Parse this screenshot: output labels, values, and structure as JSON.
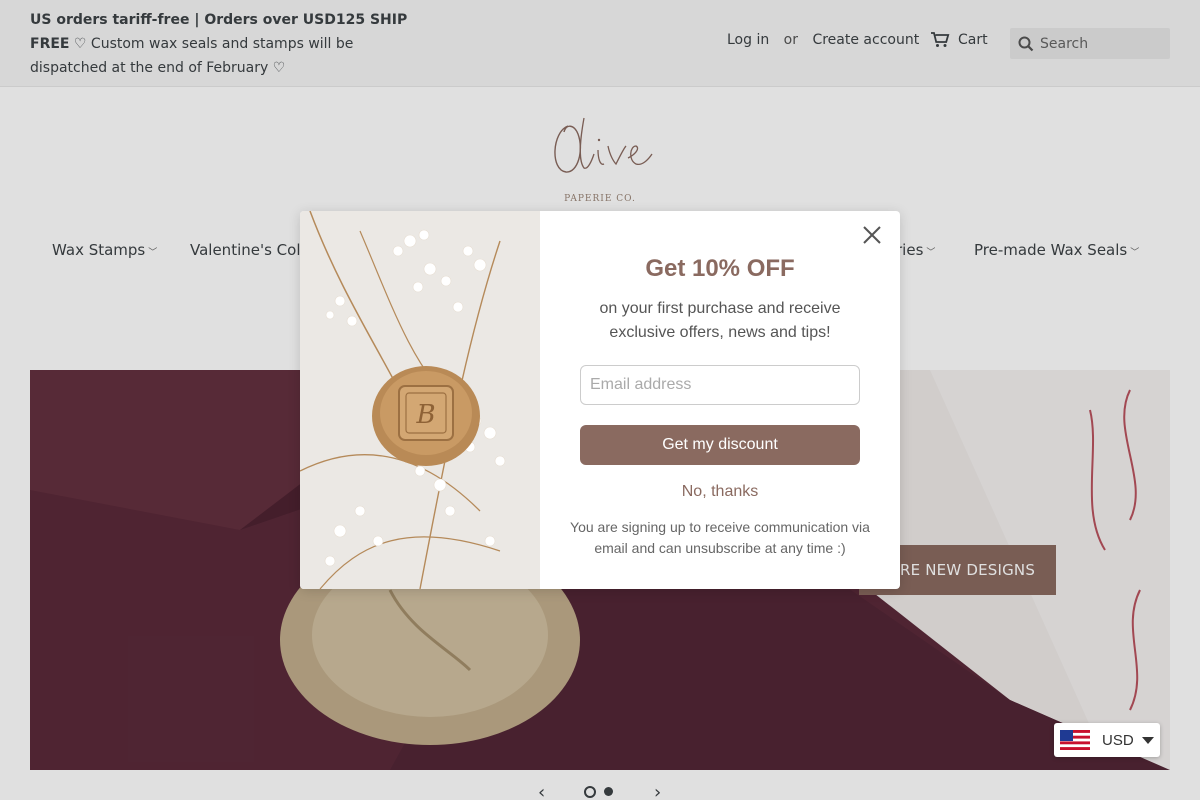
{
  "announcement": {
    "line_bold": "US orders tariff-free | Orders over USD125 SHIP FREE",
    "line_rest": " ♡ Custom wax seals and stamps will be dispatched at the end of February ♡"
  },
  "account": {
    "login": "Log in",
    "or": "or",
    "create": "Create account"
  },
  "cart": {
    "label": "Cart",
    "icon": "cart-icon"
  },
  "search": {
    "placeholder": "Search",
    "button": "SEARCH",
    "icon": "search-icon"
  },
  "logo": {
    "script": "Olive",
    "sub": "PAPERIE CO."
  },
  "nav": {
    "items": [
      {
        "label": "Wax Stamps"
      },
      {
        "label": "Valentine's Colle"
      },
      {
        "label": "ries"
      },
      {
        "label": "Pre-made Wax Seals"
      }
    ]
  },
  "hero": {
    "cta": "LORE NEW DESIGNS"
  },
  "slider": {
    "prev": "‹",
    "next": "›",
    "active_index": 0,
    "count": 2
  },
  "popup": {
    "title": "Get 10% OFF",
    "description": "on your first purchase and receive exclusive offers, news and tips!",
    "email_placeholder": "Email address",
    "submit": "Get my discount",
    "decline": "No, thanks",
    "fine_print": "You are signing up to receive communication via email and can unsubscribe at any time :)"
  },
  "currency": {
    "code": "USD",
    "flag": "us-flag-icon"
  },
  "colors": {
    "accent": "#8a6a60",
    "topbar": "#f5f5f5",
    "hero_bg": "#5b2a3b"
  }
}
